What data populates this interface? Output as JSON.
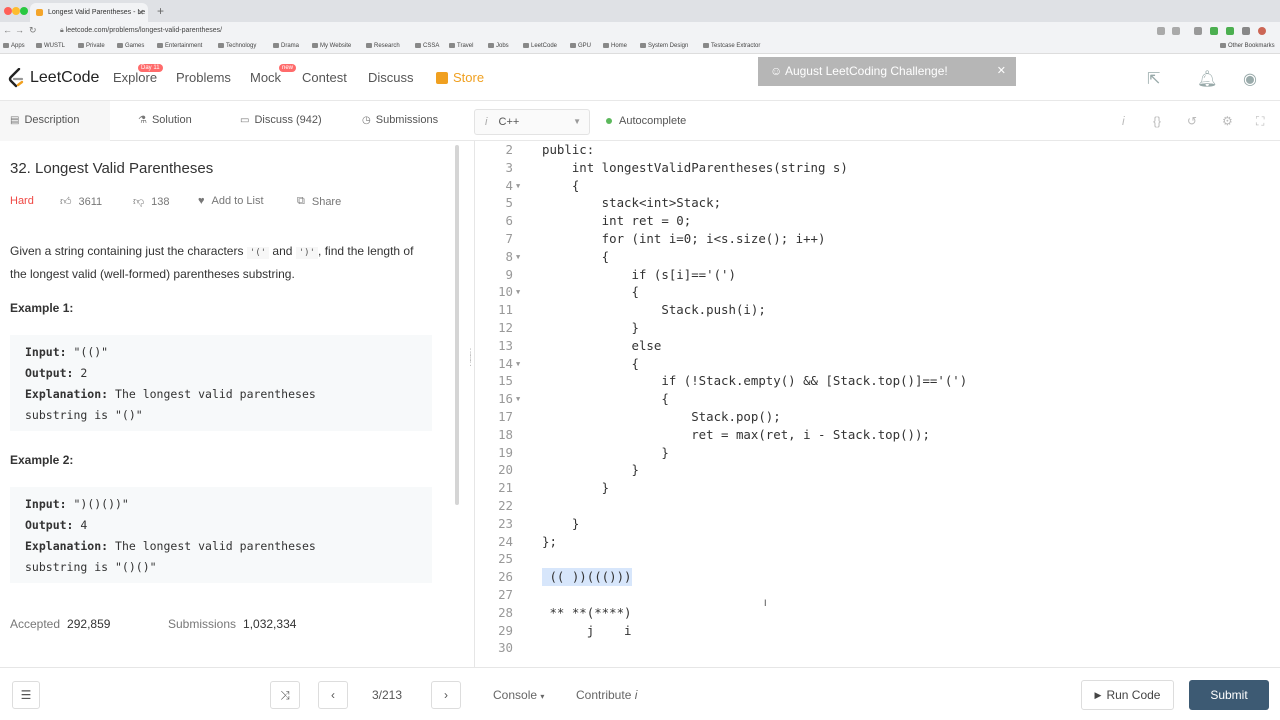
{
  "browser": {
    "tab_title": "Longest Valid Parentheses - Le",
    "url": "leetcode.com/problems/longest-valid-parentheses/",
    "bookmarks": [
      "Apps",
      "WUSTL",
      "Private",
      "Games",
      "Entertainment",
      "Technology",
      "Drama",
      "My Website",
      "Research",
      "CSSA",
      "Travel",
      "Jobs",
      "LeetCode",
      "GPU",
      "Home",
      "System Design",
      "Testcase Extractor",
      "Other Bookmarks"
    ]
  },
  "nav": {
    "logo": "LeetCode",
    "links": [
      "Explore",
      "Problems",
      "Mock",
      "Contest",
      "Discuss"
    ],
    "explore_badge": "Day 11",
    "mock_badge": "new",
    "store": "Store",
    "challenge": "August LeetCoding Challenge!",
    "challenge_close": "✕"
  },
  "subtabs": {
    "description": "Description",
    "solution": "Solution",
    "discuss": "Discuss (942)",
    "submissions": "Submissions",
    "language": "C++",
    "autocomplete": "Autocomplete"
  },
  "problem": {
    "title": "32. Longest Valid Parentheses",
    "difficulty": "Hard",
    "likes": "3611",
    "dislikes": "138",
    "add_to_list": "Add to List",
    "share": "Share",
    "desc_1": "Given a string containing just the characters ",
    "desc_paren_open": "'('",
    "desc_and": " and ",
    "desc_paren_close": "')'",
    "desc_2": ", find the length of the longest valid (well-formed) parentheses substring.",
    "example1_heading": "Example 1:",
    "example1": {
      "input_label": "Input:",
      "input": " \"(()\"",
      "output_label": "Output:",
      "output": " 2",
      "explanation_label": "Explanation:",
      "explanation_1": " The longest valid parentheses",
      "explanation_2": "substring is \"()\""
    },
    "example2_heading": "Example 2:",
    "example2": {
      "input_label": "Input:",
      "input": " \")()())\"",
      "output_label": "Output:",
      "output": " 4",
      "explanation_label": "Explanation:",
      "explanation_1": " The longest valid parentheses",
      "explanation_2": "substring is \"()()\""
    },
    "accepted_label": "Accepted",
    "accepted": "292,859",
    "submissions_label": "Submissions",
    "submissions": "1,032,334"
  },
  "code": [
    {
      "n": "2",
      "fold": false,
      "text": "public:"
    },
    {
      "n": "3",
      "fold": false,
      "text": "    int longestValidParentheses(string s)"
    },
    {
      "n": "4",
      "fold": true,
      "text": "    {"
    },
    {
      "n": "5",
      "fold": false,
      "text": "        stack<int>Stack;"
    },
    {
      "n": "6",
      "fold": false,
      "text": "        int ret = 0;"
    },
    {
      "n": "7",
      "fold": false,
      "text": "        for (int i=0; i<s.size(); i++)"
    },
    {
      "n": "8",
      "fold": true,
      "text": "        {"
    },
    {
      "n": "9",
      "fold": false,
      "text": "            if (s[i]=='(')"
    },
    {
      "n": "10",
      "fold": true,
      "text": "            {"
    },
    {
      "n": "11",
      "fold": false,
      "text": "                Stack.push(i);"
    },
    {
      "n": "12",
      "fold": false,
      "text": "            }"
    },
    {
      "n": "13",
      "fold": false,
      "text": "            else"
    },
    {
      "n": "14",
      "fold": true,
      "text": "            {"
    },
    {
      "n": "15",
      "fold": false,
      "text": "                if (!Stack.empty() && [Stack.top()]=='(')"
    },
    {
      "n": "16",
      "fold": true,
      "text": "                {"
    },
    {
      "n": "17",
      "fold": false,
      "text": "                    Stack.pop();"
    },
    {
      "n": "18",
      "fold": false,
      "text": "                    ret = max(ret, i - Stack.top());"
    },
    {
      "n": "19",
      "fold": false,
      "text": "                }"
    },
    {
      "n": "20",
      "fold": false,
      "text": "            }"
    },
    {
      "n": "21",
      "fold": false,
      "text": "        }"
    },
    {
      "n": "22",
      "fold": false,
      "text": ""
    },
    {
      "n": "23",
      "fold": false,
      "text": "    }"
    },
    {
      "n": "24",
      "fold": false,
      "text": "};"
    },
    {
      "n": "25",
      "fold": false,
      "text": ""
    },
    {
      "n": "26",
      "fold": false,
      "text": " (( ))((()))",
      "selected": true
    },
    {
      "n": "27",
      "fold": false,
      "text": ""
    },
    {
      "n": "28",
      "fold": false,
      "text": " ** **(****)"
    },
    {
      "n": "29",
      "fold": false,
      "text": "      j    i"
    },
    {
      "n": "30",
      "fold": false,
      "text": ""
    }
  ],
  "footer": {
    "counter": "3/213",
    "console": "Console",
    "contribute": "Contribute",
    "run": "Run Code",
    "submit": "Submit"
  }
}
